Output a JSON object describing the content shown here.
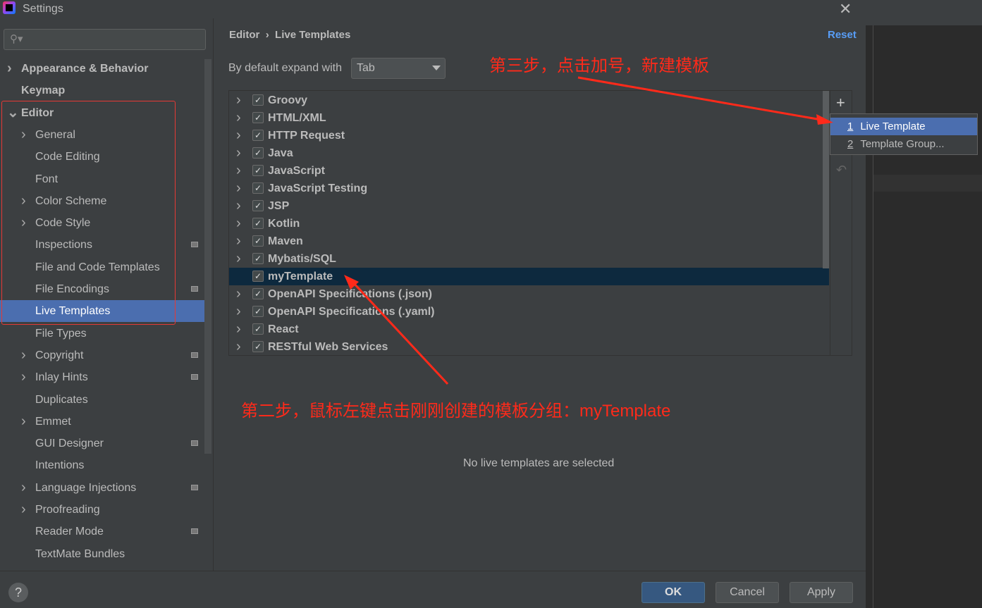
{
  "window": {
    "title": "Settings",
    "close_icon": "close-icon"
  },
  "search": {
    "placeholder": "",
    "icon": "search-icon"
  },
  "sidebar": {
    "items": [
      {
        "label": "Appearance & Behavior",
        "bold": true,
        "chevron": "right",
        "indent": 0
      },
      {
        "label": "Keymap",
        "bold": true,
        "indent": 0
      },
      {
        "label": "Editor",
        "bold": true,
        "chevron": "down",
        "indent": 0
      },
      {
        "label": "General",
        "chevron": "right",
        "indent": 1
      },
      {
        "label": "Code Editing",
        "indent": 1
      },
      {
        "label": "Font",
        "indent": 1
      },
      {
        "label": "Color Scheme",
        "chevron": "right",
        "indent": 1
      },
      {
        "label": "Code Style",
        "chevron": "right",
        "indent": 1
      },
      {
        "label": "Inspections",
        "indent": 1,
        "badge": true
      },
      {
        "label": "File and Code Templates",
        "indent": 1
      },
      {
        "label": "File Encodings",
        "indent": 1,
        "badge": true
      },
      {
        "label": "Live Templates",
        "indent": 1,
        "selected": true
      },
      {
        "label": "File Types",
        "indent": 1
      },
      {
        "label": "Copyright",
        "chevron": "right",
        "indent": 1,
        "badge": true
      },
      {
        "label": "Inlay Hints",
        "chevron": "right",
        "indent": 1,
        "badge": true
      },
      {
        "label": "Duplicates",
        "indent": 1
      },
      {
        "label": "Emmet",
        "chevron": "right",
        "indent": 1
      },
      {
        "label": "GUI Designer",
        "indent": 1,
        "badge": true
      },
      {
        "label": "Intentions",
        "indent": 1
      },
      {
        "label": "Language Injections",
        "chevron": "right",
        "indent": 1,
        "badge": true
      },
      {
        "label": "Proofreading",
        "chevron": "right",
        "indent": 1
      },
      {
        "label": "Reader Mode",
        "indent": 1,
        "badge": true
      },
      {
        "label": "TextMate Bundles",
        "indent": 1
      }
    ]
  },
  "main": {
    "breadcrumb": [
      "Editor",
      "Live Templates"
    ],
    "breadcrumb_sep": "›",
    "reset": "Reset",
    "expand_label": "By default expand with",
    "expand_value": "Tab",
    "groups": [
      {
        "label": "Groovy",
        "checked": true
      },
      {
        "label": "HTML/XML",
        "checked": true
      },
      {
        "label": "HTTP Request",
        "checked": true
      },
      {
        "label": "Java",
        "checked": true
      },
      {
        "label": "JavaScript",
        "checked": true
      },
      {
        "label": "JavaScript Testing",
        "checked": true
      },
      {
        "label": "JSP",
        "checked": true
      },
      {
        "label": "Kotlin",
        "checked": true
      },
      {
        "label": "Maven",
        "checked": true
      },
      {
        "label": "Mybatis/SQL",
        "checked": true
      },
      {
        "label": "myTemplate",
        "checked": true,
        "selected": true,
        "no_chevron": true
      },
      {
        "label": "OpenAPI Specifications (.json)",
        "checked": true
      },
      {
        "label": "OpenAPI Specifications (.yaml)",
        "checked": true
      },
      {
        "label": "React",
        "checked": true
      },
      {
        "label": "RESTful Web Services",
        "checked": true
      }
    ],
    "add_icon": "plus-icon",
    "undo_icon": "undo-icon",
    "popup": [
      {
        "num": "1",
        "label": "Live Template",
        "selected": true
      },
      {
        "num": "2",
        "label": "Template Group..."
      }
    ],
    "empty_text": "No live templates are selected"
  },
  "annotations": {
    "step3": "第三步，点击加号，新建模板",
    "step2": "第二步，鼠标左键点击刚刚创建的模板分组：myTemplate",
    "color": "#ff2a1a"
  },
  "footer": {
    "help": "?",
    "ok": "OK",
    "cancel": "Cancel",
    "apply": "Apply"
  }
}
